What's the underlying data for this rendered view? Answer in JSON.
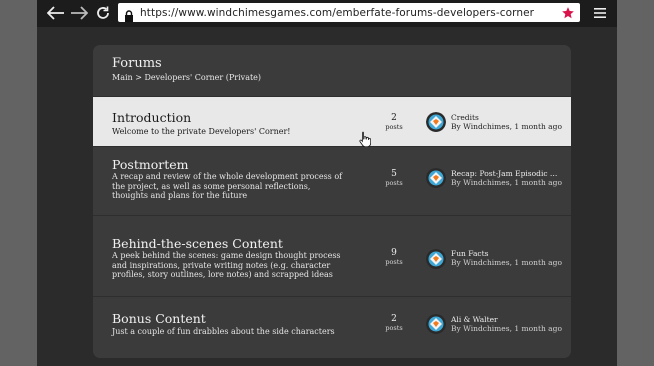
{
  "browser": {
    "url": "https://www.windchimesgames.com/emberfate-forums-developers-corner",
    "icons": [
      "back-arrow-icon",
      "forward-arrow-icon",
      "reload-icon",
      "lock-icon",
      "star-icon",
      "hamburger-menu-icon"
    ],
    "star_color": "#d9124a"
  },
  "forum": {
    "title": "Forums",
    "breadcrumb": "Main > Developers' Corner (Private)",
    "threads": [
      {
        "title": "Introduction",
        "description": "Welcome to the private Developers' Corner!",
        "posts": "2",
        "posts_label": "posts",
        "last_title": "Credits",
        "last_meta": "By Windchimes, 1 month ago",
        "active": true
      },
      {
        "title": "Postmortem",
        "description": "A recap and review of the whole development process of the project, as well as some personal reflections, thoughts and plans for the future",
        "posts": "5",
        "posts_label": "posts",
        "last_title": "Recap: Post-Jam Episodic Rel...",
        "last_meta": "By Windchimes, 1 month ago",
        "active": false
      },
      {
        "title": "Behind-the-scenes Content",
        "description": "A peek behind the scenes: game design thought process and inspirations, private writing notes (e.g. character profiles, story outlines, lore notes) and scrapped ideas",
        "posts": "9",
        "posts_label": "posts",
        "last_title": "Fun Facts",
        "last_meta": "By Windchimes, 1 month ago",
        "active": false
      },
      {
        "title": "Bonus Content",
        "description": "Just a couple of fun drabbles about the side characters",
        "posts": "2",
        "posts_label": "posts",
        "last_title": "Ali & Walter",
        "last_meta": "By Windchimes, 1 month ago",
        "active": false
      }
    ]
  }
}
